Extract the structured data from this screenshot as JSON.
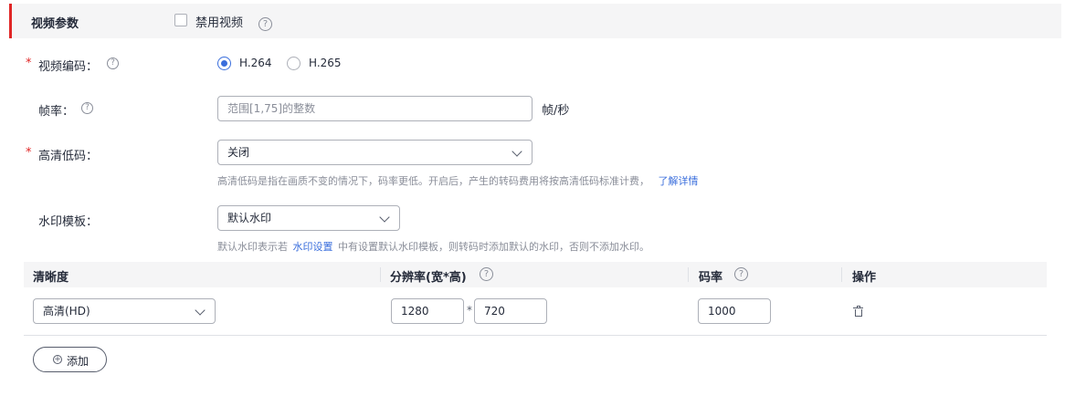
{
  "section": {
    "title": "视频参数",
    "disable_video_label": "禁用视频",
    "accent_color": "#e02626"
  },
  "icons": {
    "help": "?",
    "plus": "+"
  },
  "form": {
    "codec": {
      "required_mark": "*",
      "label": "视频编码：",
      "options": [
        {
          "label": "H.264",
          "checked": true
        },
        {
          "label": "H.265",
          "checked": false
        }
      ]
    },
    "frame_rate": {
      "label": "帧率：",
      "placeholder": "范围[1,75]的整数",
      "unit": "帧/秒"
    },
    "hd_low_bitrate": {
      "required_mark": "*",
      "label": "高清低码：",
      "value": "关闭",
      "hint": "高清低码是指在画质不变的情况下，码率更低。开启后，产生的转码费用将按高清低码标准计费，",
      "hint_link": "了解详情"
    },
    "watermark": {
      "label": "水印模板：",
      "value": "默认水印",
      "hint_before": "默认水印表示若",
      "hint_link": "水印设置",
      "hint_after": "中有设置默认水印模板，则转码时添加默认的水印，否则不添加水印。"
    }
  },
  "table": {
    "headers": {
      "definition": "清晰度",
      "resolution": "分辨率(宽*高)",
      "bitrate": "码率",
      "actions": "操作"
    },
    "rows": [
      {
        "definition": "高清(HD)",
        "width": "1280",
        "times": "*",
        "height": "720",
        "bitrate": "1000"
      }
    ],
    "add_label": "添加"
  },
  "colors": {
    "accent_blue": "#3a6edc",
    "required_red": "#e02626",
    "header_bg": "#f5f5f6"
  }
}
